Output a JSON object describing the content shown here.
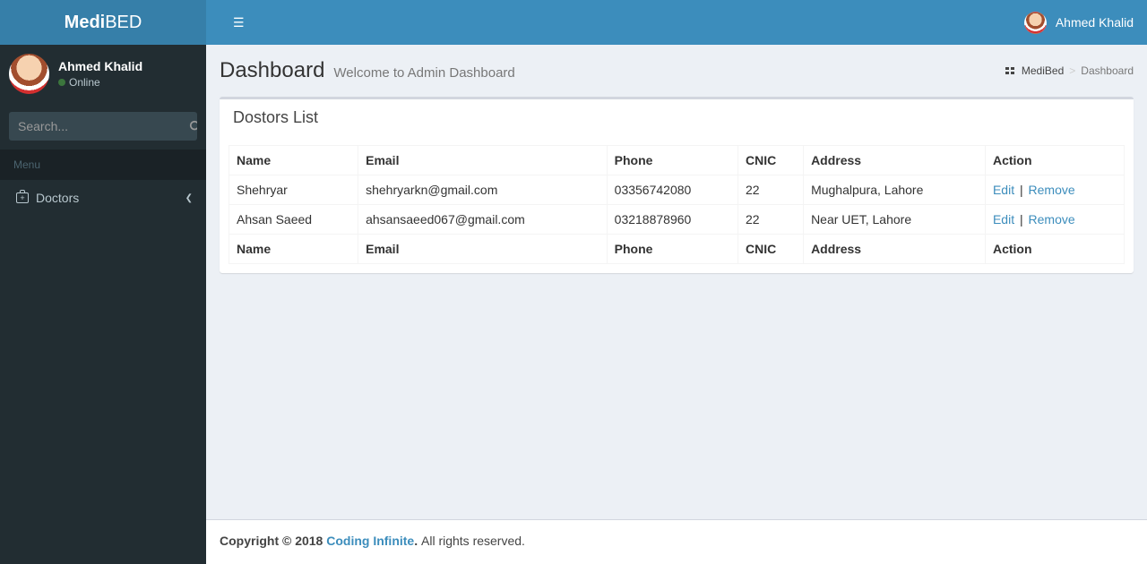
{
  "logo": {
    "bold": "Medi",
    "light": "BED"
  },
  "header": {
    "user_name": "Ahmed Khalid"
  },
  "sidebar": {
    "user": {
      "name": "Ahmed Khalid",
      "status": "Online"
    },
    "search_placeholder": "Search...",
    "menu_header": "Menu",
    "items": [
      {
        "label": "Doctors"
      }
    ]
  },
  "page": {
    "title": "Dashboard",
    "subtitle": "Welcome to Admin Dashboard",
    "breadcrumb": {
      "root": "MediBed",
      "current": "Dashboard"
    },
    "box_title": "Dostors List"
  },
  "table": {
    "headers": {
      "name": "Name",
      "email": "Email",
      "phone": "Phone",
      "cnic": "CNIC",
      "address": "Address",
      "action": "Action"
    },
    "rows": [
      {
        "name": "Shehryar",
        "email": "shehryarkn@gmail.com",
        "phone": "03356742080",
        "cnic": "22",
        "address": "Mughalpura, Lahore"
      },
      {
        "name": "Ahsan Saeed",
        "email": "ahsansaeed067@gmail.com",
        "phone": "03218878960",
        "cnic": "22",
        "address": "Near UET, Lahore"
      }
    ],
    "actions": {
      "edit": "Edit",
      "remove": "Remove",
      "sep": "|"
    }
  },
  "footer": {
    "copyright_prefix": "Copyright © 2018 ",
    "link_text": "Coding Infinite",
    "suffix": " All rights reserved."
  }
}
